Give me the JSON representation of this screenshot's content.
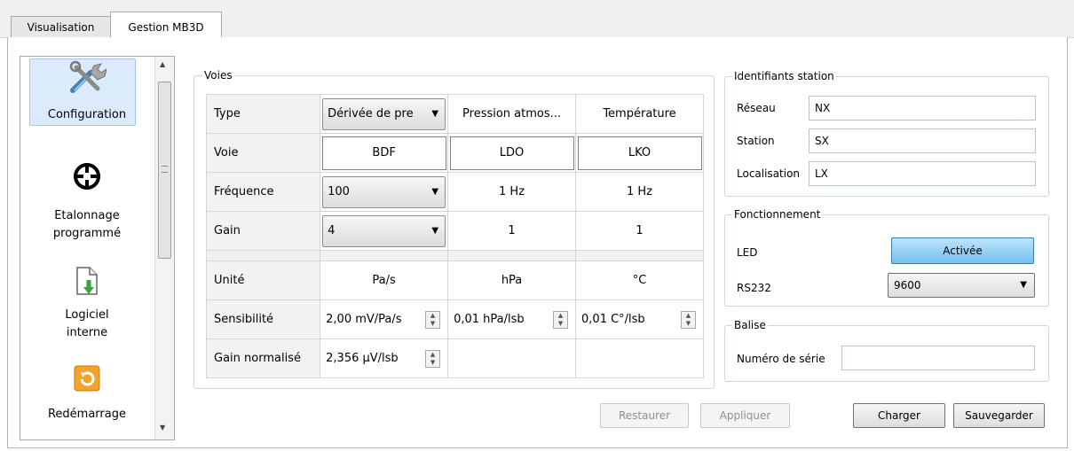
{
  "tabs": [
    {
      "label": "Visualisation",
      "active": false
    },
    {
      "label": "Gestion MB3D",
      "active": true
    }
  ],
  "nav": {
    "items": [
      {
        "label": "Configuration",
        "icon": "tools-icon",
        "selected": true
      },
      {
        "label_line1": "Etalonnage",
        "label_line2": "programmé",
        "icon": "crosshair-icon"
      },
      {
        "label_line1": "Logiciel",
        "label_line2": "interne",
        "icon": "document-download-icon"
      },
      {
        "label": "Redémarrage",
        "icon": "restart-icon"
      }
    ]
  },
  "voies": {
    "title": "Voies",
    "row_headers": {
      "type": "Type",
      "voie": "Voie",
      "frequence": "Fréquence",
      "gain": "Gain",
      "unite": "Unité",
      "sensibilite": "Sensibilité",
      "gain_normalise": "Gain normalisé"
    },
    "columns": [
      {
        "type": "Dérivée de pre",
        "voie": "BDF",
        "frequence": "100",
        "gain": "4",
        "unite": "Pa/s",
        "sensibilite": "2,00 mV/Pa/s",
        "gain_normalise": "2,356 µV/lsb"
      },
      {
        "type": "Pression atmos...",
        "voie": "LDO",
        "frequence": "1 Hz",
        "gain": "1",
        "unite": "hPa",
        "sensibilite": "0,01 hPa/lsb"
      },
      {
        "type": "Température",
        "voie": "LKO",
        "frequence": "1 Hz",
        "gain": "1",
        "unite": "°C",
        "sensibilite": "0,01 C°/lsb"
      }
    ]
  },
  "identifiants": {
    "title": "Identifiants station",
    "reseau_label": "Réseau",
    "reseau_value": "NX",
    "station_label": "Station",
    "station_value": "SX",
    "localisation_label": "Localisation",
    "localisation_value": "LX"
  },
  "fonctionnement": {
    "title": "Fonctionnement",
    "led_label": "LED",
    "led_button": "Activée",
    "rs232_label": "RS232",
    "rs232_value": "9600"
  },
  "balise": {
    "title": "Balise",
    "serie_label": "Numéro de série",
    "serie_value": ""
  },
  "buttons": {
    "restaurer": "Restaurer",
    "appliquer": "Appliquer",
    "charger": "Charger",
    "sauvegarder": "Sauvegarder"
  },
  "colors": {
    "selection_bg": "#dcebfc",
    "active_button": "#72c1ef",
    "restart_icon": "#f0a42a"
  }
}
